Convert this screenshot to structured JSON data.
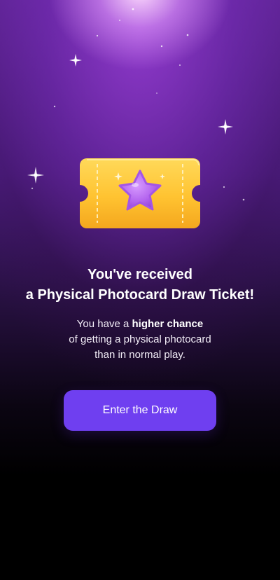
{
  "title": {
    "line1": "You've received",
    "line2": "a Physical Photocard Draw Ticket!"
  },
  "description": {
    "line1_prefix": "You have a ",
    "line1_bold": "higher chance",
    "line2": "of getting a physical photocard",
    "line3": "than in normal play."
  },
  "cta": {
    "label": "Enter the Draw"
  },
  "colors": {
    "accent": "#6f3ff0",
    "ticket": "#ffc83a",
    "star": "#b46cf0"
  },
  "icons": {
    "ticket": "ticket-star-icon",
    "sparkle": "sparkle-icon"
  }
}
